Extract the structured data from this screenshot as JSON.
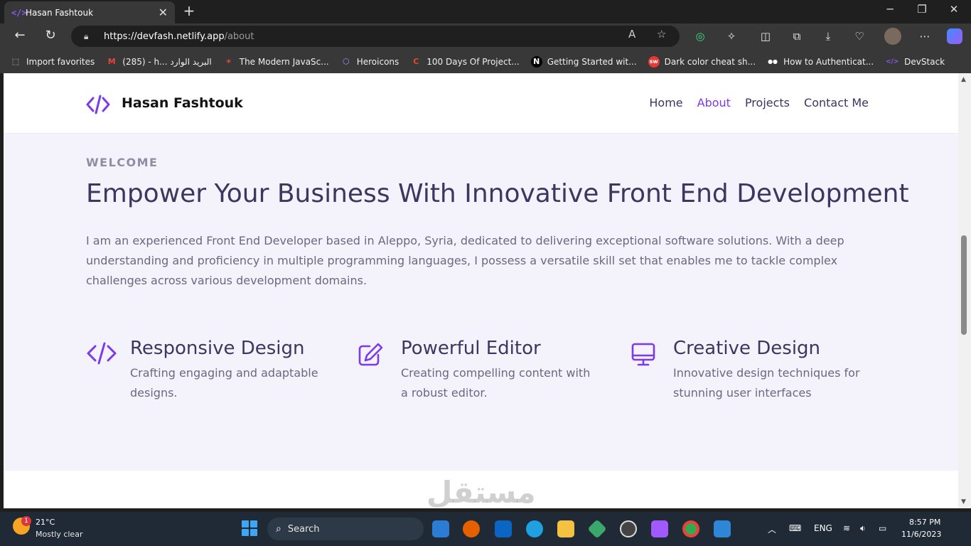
{
  "browser": {
    "tab_title": "Hasan Fashtouk",
    "tab_favicon": "</>",
    "tab_close": "✕",
    "new_tab": "+",
    "url_host": "https://devfash.netlify.app",
    "url_path": "/about",
    "read_aloud": "A",
    "favorite_star": "☆"
  },
  "favorites": [
    {
      "label": "Import favorites",
      "icon": "import-icon",
      "color": "#cfcfcf",
      "glyph": "⬚"
    },
    {
      "label": "(285) - h... البريد الوارد",
      "icon": "gmail-icon",
      "color": "#ea4335",
      "glyph": "M"
    },
    {
      "label": "The Modern JavaSc...",
      "icon": "javascript-info-icon",
      "color": "#e84a3b",
      "glyph": "✶"
    },
    {
      "label": "Heroicons",
      "icon": "heroicons-icon",
      "color": "#a78bfa",
      "glyph": "⬡"
    },
    {
      "label": "100 Days Of Project...",
      "icon": "100days-icon",
      "color": "#e34c26",
      "glyph": "C"
    },
    {
      "label": "Getting Started wit...",
      "icon": "nextjs-icon",
      "color": "#ffffff",
      "glyph": "N"
    },
    {
      "label": "Dark color cheat sh...",
      "icon": "sw-icon",
      "color": "#e53935",
      "glyph": "sw"
    },
    {
      "label": "How to Authenticat...",
      "icon": "medium-icon",
      "color": "#ffffff",
      "glyph": "●●"
    },
    {
      "label": "DevStack",
      "icon": "devstack-icon",
      "color": "#8b5cf6",
      "glyph": "</>"
    }
  ],
  "site": {
    "brand": "Hasan Fashtouk",
    "nav": [
      {
        "label": "Home",
        "active": false
      },
      {
        "label": "About",
        "active": true
      },
      {
        "label": "Projects",
        "active": false
      },
      {
        "label": "Contact Me",
        "active": false
      }
    ],
    "welcome": "WELCOME",
    "headline": "Empower Your Business With Innovative Front End Development",
    "intro": "I am an experienced Front End Developer based in Aleppo, Syria, dedicated to delivering exceptional software solutions. With a deep understanding and proficiency in multiple programming languages, I possess a versatile skill set that enables me to tackle complex challenges across various development domains.",
    "features": [
      {
        "title": "Responsive Design",
        "desc": "Crafting engaging and adaptable designs.",
        "icon": "code-icon"
      },
      {
        "title": "Powerful Editor",
        "desc": "Creating compelling content with a robust editor.",
        "icon": "pencil-square-icon"
      },
      {
        "title": "Creative Design",
        "desc": "Innovative design techniques for stunning user interfaces",
        "icon": "monitor-icon"
      }
    ],
    "accent_color": "#7c3aed"
  },
  "watermark": "مستقل",
  "taskbar": {
    "weather_temp": "21°C",
    "weather_desc": "Mostly clear",
    "weather_badge": "1",
    "search_label": "Search",
    "lang": "ENG",
    "time": "8:57 PM",
    "date": "11/6/2023"
  }
}
